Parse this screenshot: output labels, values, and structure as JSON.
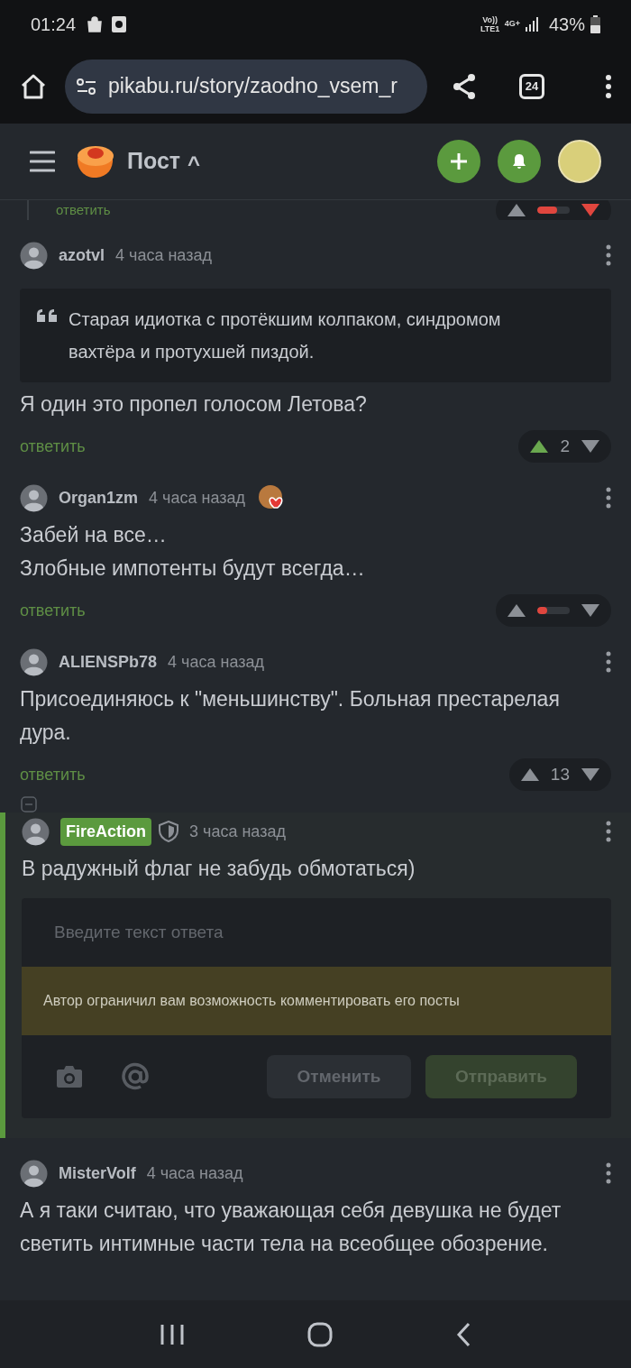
{
  "status_bar": {
    "time": "01:24",
    "network": "Vo)) LTE1",
    "signal_type": "4G+",
    "battery": "43%"
  },
  "browser": {
    "url": "pikabu.ru/story/zaodno_vsem_r",
    "tab_count": "24"
  },
  "header": {
    "title": "Пост",
    "caret": "^"
  },
  "comments": [
    {
      "kind": "partial",
      "reply": "ответить",
      "rating": {
        "kind": "bar",
        "level": 0.6,
        "upvoted": false,
        "downvoted": true
      }
    },
    {
      "kind": "comment",
      "author": "azotvl",
      "time": "4 часа назад",
      "quote": "Старая идиотка с протёкшим колпаком, синдромом вахтёра и протухшей пиздой.",
      "lines": [
        "Я один это пропел голосом Летова?"
      ],
      "reply": "ответить",
      "rating": {
        "kind": "score",
        "score": "2",
        "upvoted": true,
        "downvoted": false
      }
    },
    {
      "kind": "comment",
      "author": "Organ1zm",
      "time": "4 часа назад",
      "award": true,
      "lines": [
        "Забей на все…",
        "Злобные импотенты будут всегда…"
      ],
      "reply": "ответить",
      "rating": {
        "kind": "bar",
        "level": 0.3,
        "upvoted": false,
        "downvoted": false
      }
    },
    {
      "kind": "comment",
      "author": "ALIENSPb78",
      "time": "4 часа назад",
      "lines": [
        "Присоединяюсь к \"меньшинству\". Больная престарелая дура."
      ],
      "reply": "ответить",
      "rating": {
        "kind": "score",
        "score": "13",
        "upvoted": false,
        "downvoted": false
      }
    },
    {
      "kind": "comment",
      "highlighted": true,
      "author": "FireAction",
      "moderator": true,
      "time": "3 часа назад",
      "lines": [
        "В радужный флаг не забудь обмотаться)"
      ],
      "reply_form": {
        "placeholder": "Введите текст ответа",
        "notice": "Автор ограничил вам возможность комментировать его посты",
        "cancel": "Отменить",
        "submit": "Отправить"
      }
    },
    {
      "kind": "comment",
      "author": "MisterVolf",
      "time": "4 часа назад",
      "lines": [
        "А я таки считаю, что уважающая себя девушка не будет светить интимные части тела на всеобщее обозрение."
      ]
    }
  ]
}
